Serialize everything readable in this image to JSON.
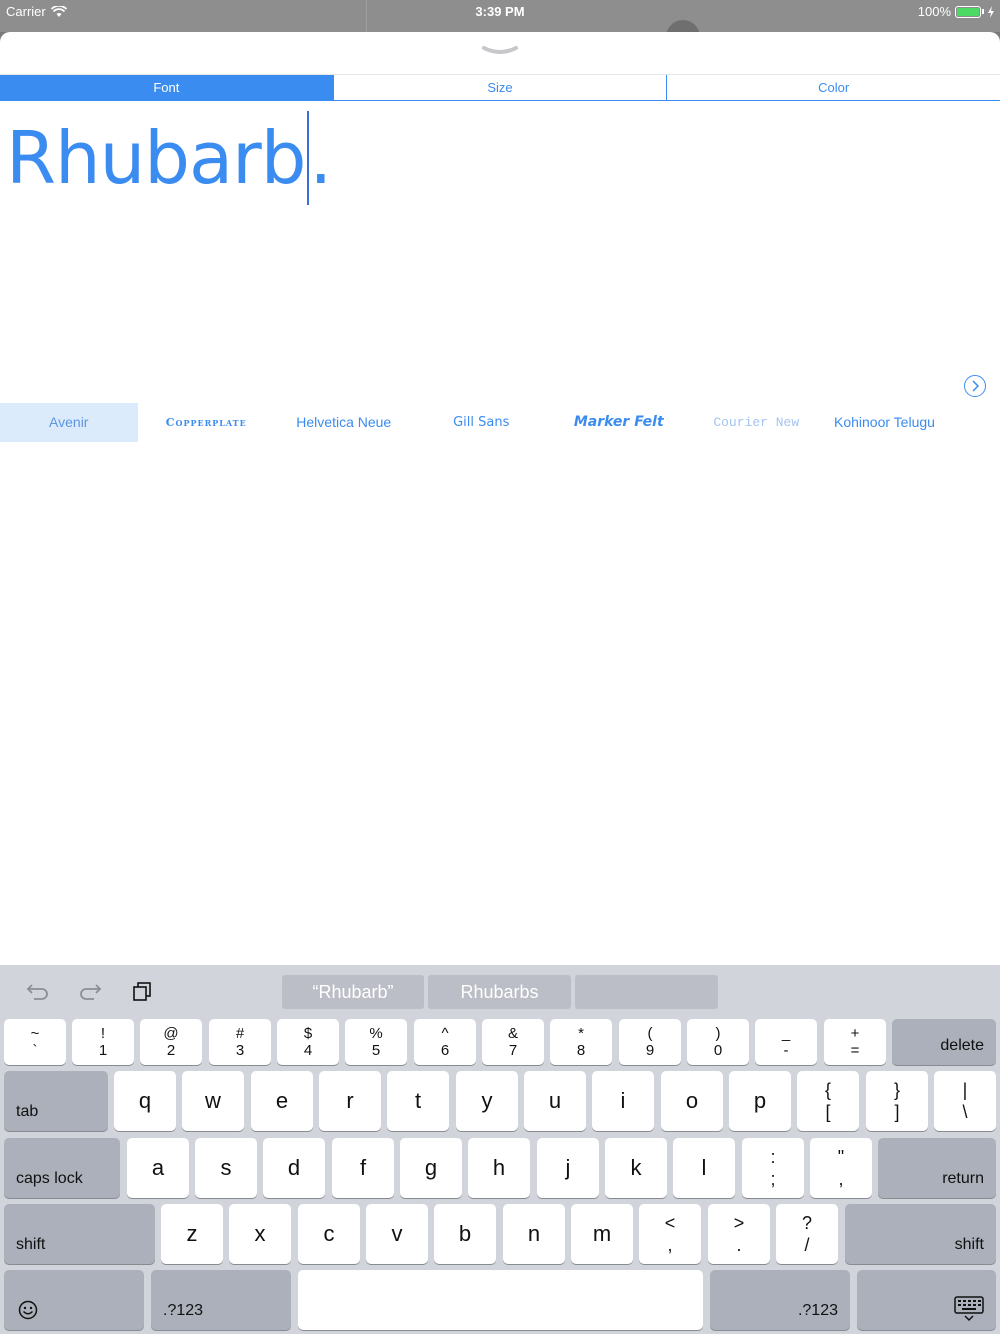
{
  "status": {
    "carrier": "Carrier",
    "time": "3:39 PM",
    "battery": "100%"
  },
  "tabs": [
    {
      "label": "Font",
      "active": true
    },
    {
      "label": "Size",
      "active": false
    },
    {
      "label": "Color",
      "active": false
    }
  ],
  "editor": {
    "text": "Rhubarb",
    "trailing": "."
  },
  "fonts": [
    "Avenir",
    "Copperplate",
    "Helvetica Neue",
    "Gill Sans",
    "Marker Felt",
    "Courier New",
    "Kohinoor Telugu"
  ],
  "selected_font": "Avenir",
  "keyboard": {
    "suggestions": [
      "“Rhubarb”",
      "Rhubarbs",
      ""
    ],
    "row1": [
      {
        "top": "~",
        "bottom": "`"
      },
      {
        "top": "!",
        "bottom": "1"
      },
      {
        "top": "@",
        "bottom": "2"
      },
      {
        "top": "#",
        "bottom": "3"
      },
      {
        "top": "$",
        "bottom": "4"
      },
      {
        "top": "%",
        "bottom": "5"
      },
      {
        "top": "^",
        "bottom": "6"
      },
      {
        "top": "&",
        "bottom": "7"
      },
      {
        "top": "*",
        "bottom": "8"
      },
      {
        "top": "(",
        "bottom": "9"
      },
      {
        "top": ")",
        "bottom": "0"
      },
      {
        "top": "_",
        "bottom": "-"
      },
      {
        "top": "+",
        "bottom": "="
      }
    ],
    "delete": "delete",
    "tab": "tab",
    "row2": [
      "q",
      "w",
      "e",
      "r",
      "t",
      "y",
      "u",
      "i",
      "o",
      "p"
    ],
    "row2_sym": [
      {
        "top": "{",
        "bottom": "["
      },
      {
        "top": "}",
        "bottom": "]"
      },
      {
        "top": "|",
        "bottom": "\\"
      }
    ],
    "caps": "caps lock",
    "row3": [
      "a",
      "s",
      "d",
      "f",
      "g",
      "h",
      "j",
      "k",
      "l"
    ],
    "row3_sym": [
      {
        "top": ":",
        "bottom": ";"
      },
      {
        "top": "\"",
        "bottom": ","
      }
    ],
    "return": "return",
    "shift": "shift",
    "row4": [
      "z",
      "x",
      "c",
      "v",
      "b",
      "n",
      "m"
    ],
    "row4_sym": [
      {
        "top": "<",
        "bottom": ","
      },
      {
        "top": ">",
        "bottom": "."
      },
      {
        "top": "?",
        "bottom": "/"
      }
    ],
    "numbers_key": ".?123"
  }
}
